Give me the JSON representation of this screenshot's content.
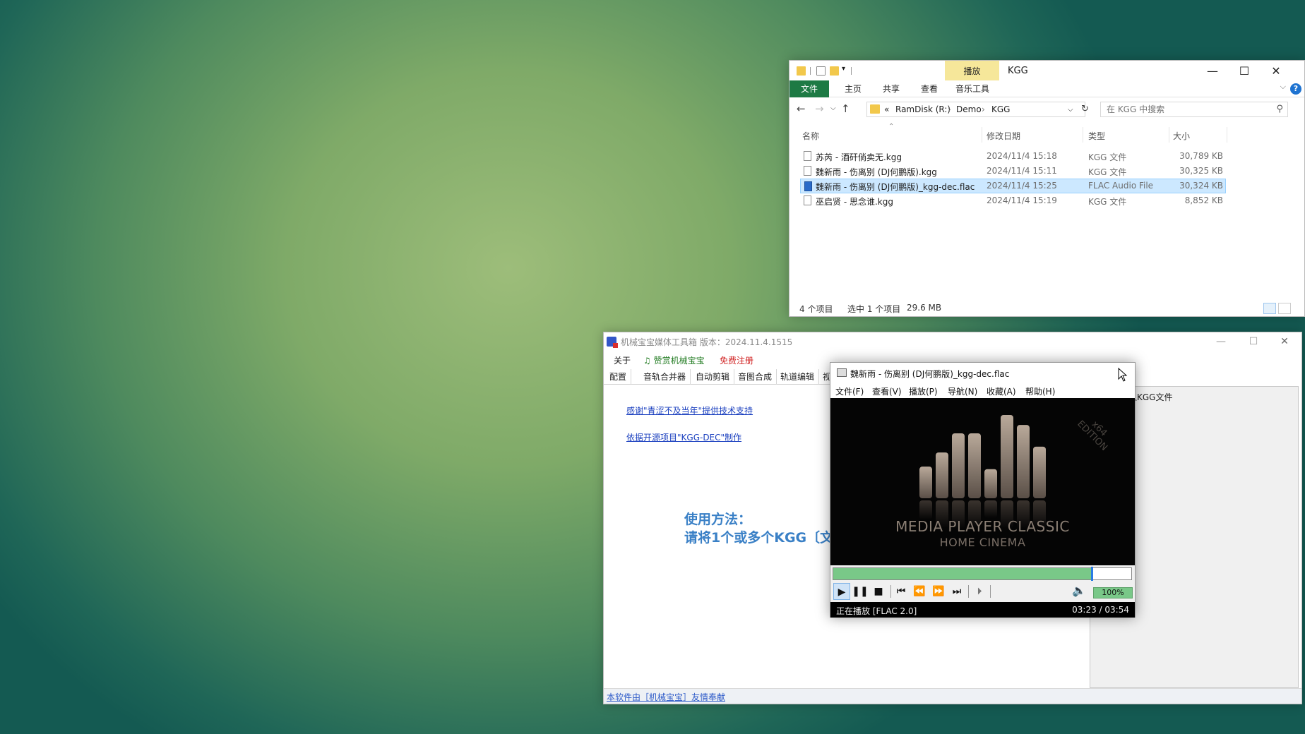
{
  "explorer": {
    "ribbon_context_tab": "播放",
    "title": "KGG",
    "ribbon_tabs": [
      "文件",
      "主页",
      "共享",
      "查看",
      "音乐工具"
    ],
    "address": {
      "prefix": "«",
      "parts": [
        "RamDisk (R:)",
        "Demo",
        "KGG"
      ]
    },
    "search_placeholder": "在 KGG 中搜索",
    "columns": [
      "名称",
      "修改日期",
      "类型",
      "大小"
    ],
    "files": [
      {
        "name": "苏芮 - 酒矸倘卖无.kgg",
        "date": "2024/11/4 15:18",
        "type": "KGG 文件",
        "size": "30,789 KB",
        "selected": false,
        "icon": "file-icon"
      },
      {
        "name": "魏新雨 - 伤离别 (DJ何鹏版).kgg",
        "date": "2024/11/4 15:11",
        "type": "KGG 文件",
        "size": "30,325 KB",
        "selected": false,
        "icon": "file-icon"
      },
      {
        "name": "魏新雨 - 伤离别 (DJ何鹏版)_kgg-dec.flac",
        "date": "2024/11/4 15:25",
        "type": "FLAC Audio File",
        "size": "30,324 KB",
        "selected": true,
        "icon": "flac-file-icon"
      },
      {
        "name": "巫启贤 - 思念谁.kgg",
        "date": "2024/11/4 15:19",
        "type": "KGG 文件",
        "size": "8,852 KB",
        "selected": false,
        "icon": "file-icon"
      }
    ],
    "status": {
      "count": "4 个项目",
      "selected": "选中 1 个项目",
      "size": "29.6 MB"
    },
    "colors": {
      "file_tab": "#1d7a44",
      "context_tab": "#f6e79a",
      "selection": "#cce8ff"
    }
  },
  "toolbox": {
    "title": "机械宝宝媒体工具箱 版本：2024.11.4.1515",
    "menu": {
      "about": "关于",
      "like": "♫ 赞赏机械宝宝",
      "register": "免费注册"
    },
    "tabs": [
      "配置",
      "音轨合并器",
      "自动剪辑",
      "音图合成",
      "轨道编辑",
      "视"
    ],
    "links": [
      "感谢\"青涩不及当年\"提供技术支持",
      "依据开源项目\"KGG-DEC\"制作"
    ],
    "usage_line1": "使用方法：",
    "usage_line2": "请将1个或多个KGG〔文",
    "right_panel_text": "入KGG文件",
    "footer": "本软件由［机械宝宝］友情奉献",
    "colors": {
      "register": "#d02020",
      "like": "#1f7a1f",
      "usage": "#3a80c6"
    }
  },
  "mpc": {
    "title": "魏新雨 - 伤离别 (DJ何鹏版)_kgg-dec.flac",
    "menu": [
      "文件(F)",
      "查看(V)",
      "播放(P)",
      "导航(N)",
      "收藏(A)",
      "帮助(H)"
    ],
    "logo_line1": "MEDIA PLAYER CLASSIC",
    "logo_line2": "HOME CINEMA",
    "edition": "x64 EDITION",
    "seek_fraction": 0.867,
    "volume": "100%",
    "status": "正在播放 [FLAC 2.0]",
    "time": "03:23 / 03:54",
    "eq_bar_levels": [
      0.38,
      0.55,
      0.78,
      0.78,
      0.35,
      1.0,
      0.88,
      0.62
    ],
    "colors": {
      "seek": "#79c888",
      "thumb": "#2a7be4"
    }
  }
}
